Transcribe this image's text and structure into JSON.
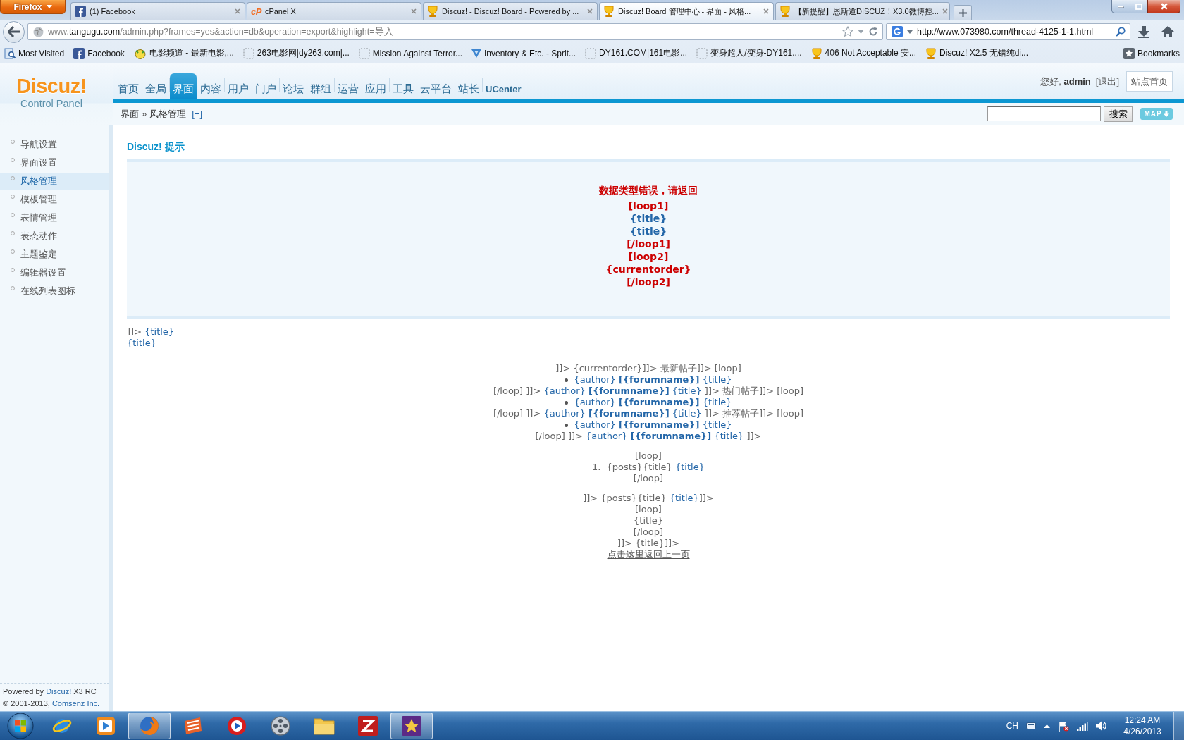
{
  "browser": {
    "menu_button": "Firefox",
    "tabs": [
      {
        "title": "(1) Facebook",
        "kind": "social",
        "selected": false
      },
      {
        "title": "cPanel X",
        "kind": "letters",
        "logo_text": "cP",
        "selected": false
      },
      {
        "title": "Discuz! - Discuz! Board - Powered by ...",
        "kind": "trophy",
        "selected": false
      },
      {
        "title": "Discuz! Board 管理中心 - 界面 - 风格...",
        "kind": "trophy",
        "selected": true
      },
      {
        "title": "【新提醒】恩斯道DISCUZ！X3.0微博控...",
        "kind": "trophy",
        "selected": false
      }
    ],
    "address": {
      "prefix": "www.",
      "domain": "tangugu.com",
      "path": "/admin.php?frames=yes&action=db&operation=export&highlight=导入"
    },
    "search": {
      "value": "http://www.073980.com/thread-4125-1-1.html"
    },
    "bookmarks": [
      {
        "label": "Most Visited",
        "kind": "pages"
      },
      {
        "label": "Facebook",
        "kind": "social"
      },
      {
        "label": "电影频道 - 最新电影,...",
        "kind": "mascot"
      },
      {
        "label": "263电影网|dy263.com|...",
        "kind": "blank"
      },
      {
        "label": "Mission Against Terror...",
        "kind": "blank"
      },
      {
        "label": "Inventory & Etc. - Sprit...",
        "kind": "triangle"
      },
      {
        "label": "DY161.COM|161电影...",
        "kind": "blank"
      },
      {
        "label": "变身超人/变身-DY161....",
        "kind": "blank"
      },
      {
        "label": "406 Not Acceptable 安...",
        "kind": "trophy"
      },
      {
        "label": "Discuz! X2.5 无错纯di...",
        "kind": "trophy"
      }
    ],
    "bookmarks_menu": "Bookmarks"
  },
  "admin": {
    "logo": {
      "title": "Discuz!",
      "subtitle": "Control Panel"
    },
    "nav": [
      {
        "label": "首页",
        "kind": "section",
        "selected": false
      },
      {
        "label": "全局",
        "kind": "section",
        "selected": false
      },
      {
        "label": "界面",
        "kind": "section",
        "selected": true
      },
      {
        "label": "内容",
        "kind": "section",
        "selected": false
      },
      {
        "label": "用户",
        "kind": "section",
        "selected": false
      },
      {
        "label": "门户",
        "kind": "section",
        "selected": false
      },
      {
        "label": "论坛",
        "kind": "section",
        "selected": false
      },
      {
        "label": "群组",
        "kind": "section",
        "selected": false
      },
      {
        "label": "运营",
        "kind": "section",
        "selected": false
      },
      {
        "label": "应用",
        "kind": "section",
        "selected": false
      },
      {
        "label": "工具",
        "kind": "section",
        "selected": false
      },
      {
        "label": "云平台",
        "kind": "section",
        "selected": false
      },
      {
        "label": "站长",
        "kind": "section",
        "selected": false
      },
      {
        "label": "UCenter",
        "kind": "app",
        "selected": false
      }
    ],
    "user": {
      "greeting": "您好, **admin**",
      "logout": "[退出]",
      "home_button": "站点首页"
    },
    "breadcrumb": {
      "items": [
        "界面",
        "风格管理"
      ],
      "separator": "»",
      "add_link": "[+]"
    },
    "search_button": "搜索",
    "map_button": "MAP",
    "sidebar": {
      "items": [
        {
          "label": "导航设置",
          "selected": false
        },
        {
          "label": "界面设置",
          "selected": false
        },
        {
          "label": "风格管理",
          "selected": true
        },
        {
          "label": "模板管理",
          "selected": false
        },
        {
          "label": "表情管理",
          "selected": false
        },
        {
          "label": "表态动作",
          "selected": false
        },
        {
          "label": "主题鉴定",
          "selected": false
        },
        {
          "label": "编辑器设置",
          "selected": false
        },
        {
          "label": "在线列表图标",
          "selected": false
        }
      ],
      "footer": [
        {
          "segments": [
            {
              "text": "Powered by ",
              "kind": "plain"
            },
            {
              "text": "Discuz!",
              "kind": "link"
            },
            {
              "text": " X3 RC",
              "kind": "plain"
            }
          ]
        },
        {
          "segments": [
            {
              "text": "© 2001-2013, ",
              "kind": "plain"
            },
            {
              "text": "Comsenz Inc.",
              "kind": "link"
            }
          ]
        }
      ]
    },
    "notice": {
      "title": "Discuz! 提示",
      "lines": [
        {
          "text": "数据类型错误，请返回",
          "kind": "error"
        },
        {
          "text": "[loop1]",
          "kind": "error"
        },
        {
          "text": "{title}",
          "kind": "link"
        },
        {
          "text": "{title}",
          "kind": "link"
        },
        {
          "text": "[/loop1]",
          "kind": "error"
        },
        {
          "text": "[loop2]",
          "kind": "error"
        },
        {
          "text": "{currentorder}",
          "kind": "error"
        },
        {
          "text": "[/loop2]",
          "kind": "error"
        }
      ]
    },
    "preview": {
      "lead_lines": [
        {
          "kind": "text",
          "segments": [
            {
              "text": "]]> ",
              "kind": "plain"
            },
            {
              "text": "{title}",
              "kind": "link"
            }
          ]
        },
        {
          "kind": "text",
          "segments": [
            {
              "text": "{title}",
              "kind": "link"
            }
          ]
        }
      ],
      "groups": [
        {
          "lines": [
            {
              "kind": "text",
              "segments": [
                {
                  "text": "]]> {currentorder}]]> 最新帖子]]> [loop]",
                  "kind": "plain"
                }
              ]
            },
            {
              "kind": "bullet",
              "segments": [
                {
                  "text": "{author}",
                  "kind": "link"
                },
                {
                  "text": "[{forumname}]",
                  "kind": "strong"
                },
                {
                  "text": "{title}",
                  "kind": "link"
                }
              ]
            },
            {
              "kind": "text",
              "segments": [
                {
                  "text": "[/loop] ]]> ",
                  "kind": "plain"
                },
                {
                  "text": "{author}",
                  "kind": "link"
                },
                {
                  "text": "[{forumname}]",
                  "kind": "strong"
                },
                {
                  "text": "{title}",
                  "kind": "link"
                },
                {
                  "text": " ]]> 热门帖子]]> [loop]",
                  "kind": "plain"
                }
              ]
            },
            {
              "kind": "bullet",
              "segments": [
                {
                  "text": "{author}",
                  "kind": "link"
                },
                {
                  "text": "[{forumname}]",
                  "kind": "strong"
                },
                {
                  "text": "{title}",
                  "kind": "link"
                }
              ]
            },
            {
              "kind": "text",
              "segments": [
                {
                  "text": "[/loop] ]]> ",
                  "kind": "plain"
                },
                {
                  "text": "{author}",
                  "kind": "link"
                },
                {
                  "text": "[{forumname}]",
                  "kind": "strong"
                },
                {
                  "text": "{title}",
                  "kind": "link"
                },
                {
                  "text": " ]]> 推荐帖子]]> [loop]",
                  "kind": "plain"
                }
              ]
            },
            {
              "kind": "bullet",
              "segments": [
                {
                  "text": "{author}",
                  "kind": "link"
                },
                {
                  "text": "[{forumname}]",
                  "kind": "strong"
                },
                {
                  "text": "{title}",
                  "kind": "link"
                }
              ]
            },
            {
              "kind": "text",
              "segments": [
                {
                  "text": "[/loop] ]]> ",
                  "kind": "plain"
                },
                {
                  "text": "{author}",
                  "kind": "link"
                },
                {
                  "text": "[{forumname}]",
                  "kind": "strong"
                },
                {
                  "text": "{title}",
                  "kind": "link"
                },
                {
                  "text": " ]]>",
                  "kind": "plain"
                }
              ]
            }
          ]
        },
        {
          "lines": [
            {
              "kind": "text",
              "segments": [
                {
                  "text": "[loop]",
                  "kind": "plain"
                }
              ]
            },
            {
              "kind": "numbered",
              "marker": "1.",
              "segments": [
                {
                  "text": "{posts}{title} ",
                  "kind": "plain"
                },
                {
                  "text": "{title}",
                  "kind": "link"
                }
              ]
            },
            {
              "kind": "text",
              "segments": [
                {
                  "text": "[/loop]",
                  "kind": "plain"
                }
              ]
            }
          ]
        },
        {
          "lines": [
            {
              "kind": "text",
              "segments": [
                {
                  "text": "]]> {posts}{title} ",
                  "kind": "plain"
                },
                {
                  "text": "{title}",
                  "kind": "link"
                },
                {
                  "text": "]]>",
                  "kind": "plain"
                }
              ]
            },
            {
              "kind": "text",
              "segments": [
                {
                  "text": "[loop]",
                  "kind": "plain"
                }
              ]
            },
            {
              "kind": "text",
              "segments": [
                {
                  "text": "{title}",
                  "kind": "plain"
                }
              ]
            },
            {
              "kind": "text",
              "segments": [
                {
                  "text": "[/loop]",
                  "kind": "plain"
                }
              ]
            },
            {
              "kind": "text",
              "segments": [
                {
                  "text": "]]> {title}]]>",
                  "kind": "plain"
                }
              ]
            }
          ]
        }
      ],
      "back_link": "点击这里返回上一页"
    }
  },
  "taskbar": {
    "apps": [
      {
        "kind": "orbit",
        "active": false
      },
      {
        "kind": "media",
        "active": false
      },
      {
        "kind": "browser",
        "active": true
      },
      {
        "kind": "stripes",
        "active": false
      },
      {
        "kind": "player",
        "active": false
      },
      {
        "kind": "reel",
        "active": false
      },
      {
        "kind": "folder",
        "active": false
      },
      {
        "kind": "zigzag",
        "active": false
      },
      {
        "kind": "tile",
        "active": true
      }
    ],
    "language": "CH",
    "time": "12:24 AM",
    "date": "4/26/2013"
  }
}
